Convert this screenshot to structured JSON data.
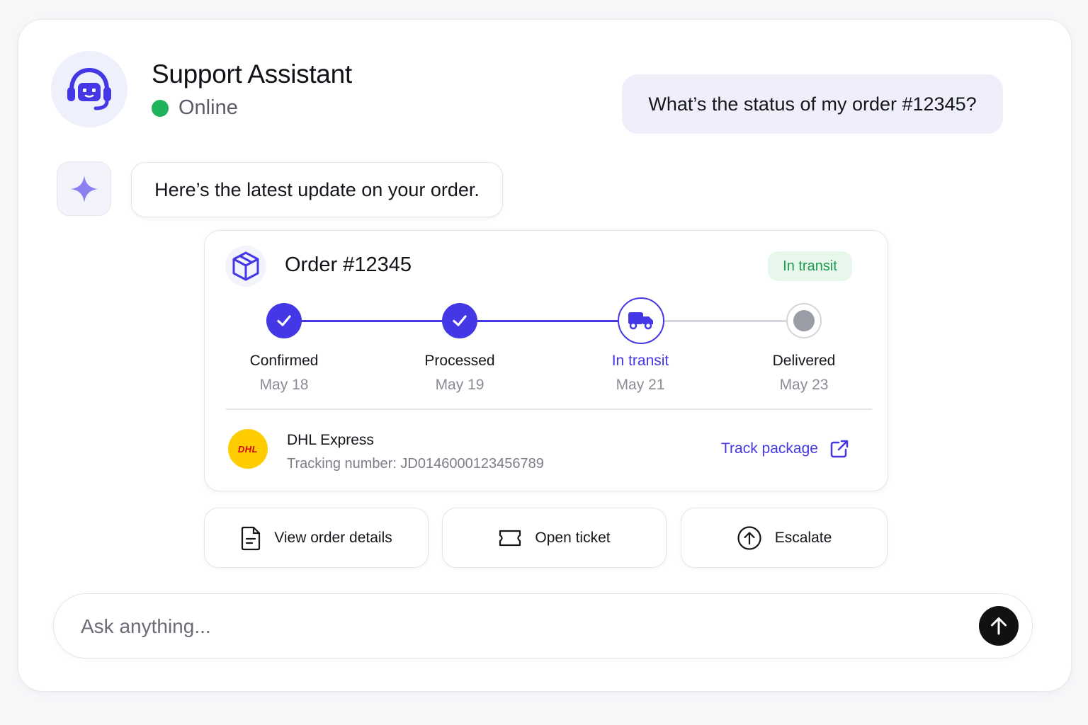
{
  "header": {
    "title": "Support Assistant",
    "status": "Online",
    "avatar_icon": "headset-bot-icon"
  },
  "messages": {
    "user": "What’s the status of my order #12345?",
    "assistant": "Here’s the latest update on your order.",
    "assistant_icon": "sparkle-icon"
  },
  "order": {
    "title": "Order #12345",
    "badge": "In transit",
    "icon": "package-icon",
    "steps": [
      {
        "label": "Confirmed",
        "date": "May 18",
        "state": "done"
      },
      {
        "label": "Processed",
        "date": "May 19",
        "state": "done"
      },
      {
        "label": "In transit",
        "date": "May 21",
        "state": "current"
      },
      {
        "label": "Delivered",
        "date": "May 23",
        "state": "pending"
      }
    ],
    "carrier": {
      "name": "DHL Express",
      "logo_text": "DHL",
      "tracking": "Tracking number: JD0146000123456789"
    },
    "track_link": "Track package"
  },
  "actions": {
    "view_details": "View order details",
    "open_ticket": "Open ticket",
    "escalate": "Escalate"
  },
  "composer": {
    "placeholder": "Ask anything..."
  },
  "colors": {
    "accent": "#4437e6",
    "online": "#1fb35b",
    "badge_bg": "#e8f7ec",
    "badge_text": "#1d9a4e",
    "dhl_yellow": "#ffcc00",
    "dhl_red": "#d40511"
  }
}
